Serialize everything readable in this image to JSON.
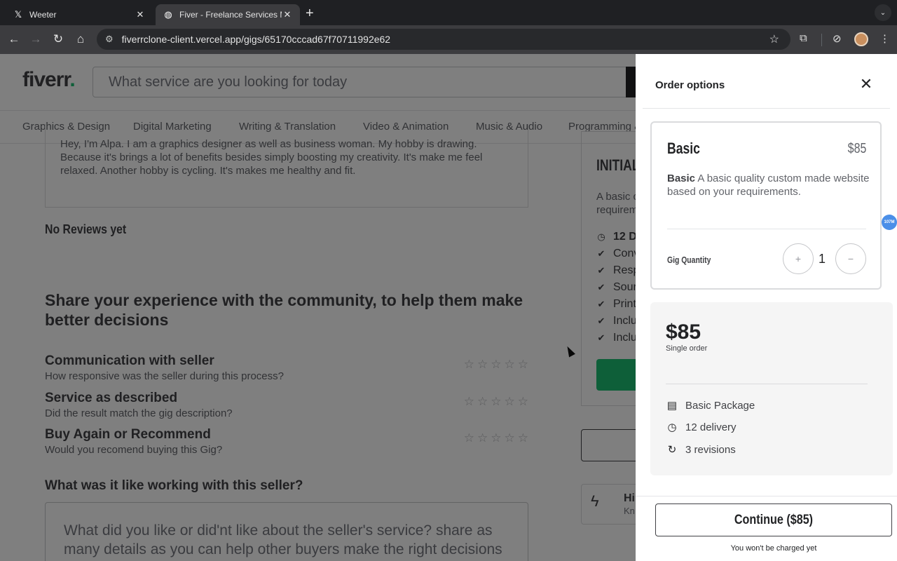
{
  "browser": {
    "tabs": [
      {
        "title": "Weeter",
        "favicon": "x-logo-icon",
        "active": false
      },
      {
        "title": "Fiver - Freelance Services Ma",
        "favicon": "globe-icon",
        "active": true
      }
    ],
    "url": "fiverrclone-client.vercel.app/gigs/65170cccad67f70711992e62"
  },
  "header": {
    "logo": "fiverr",
    "logo_dot": ".",
    "search_placeholder": "What service are you looking for today"
  },
  "categories": [
    "Graphics & Design",
    "Digital Marketing",
    "Writing & Translation",
    "Video & Animation",
    "Music & Audio",
    "Programming &"
  ],
  "seller_bio": "Hey, I'm Alpa. I am a graphics designer as well as business woman. My hobby is drawing. Because it's brings a lot of benefits besides simply boosting my creativity. It's make me feel relaxed. Another hobby is cycling. It's makes me healthy and fit.",
  "reviews": {
    "heading": "No Reviews yet",
    "share_title": "Share your experience with the community, to help them make better decisions",
    "criteria": [
      {
        "title": "Communication with seller",
        "subtitle": "How responsive was the seller during this process?"
      },
      {
        "title": "Service as described",
        "subtitle": "Did the result match the gig description?"
      },
      {
        "title": "Buy Again or Recommend",
        "subtitle": "Would you recomend buying this Gig?"
      }
    ],
    "working_title": "What was it like working with this seller?",
    "textarea_placeholder": "What did you like or did'nt like about the seller's service? share as many details as you can help other buyers make the right decisions fro their"
  },
  "package_card": {
    "name": "INITIAL I",
    "desc_line1": "A basic c",
    "desc_line2": "requirem",
    "lines": [
      {
        "icon": "clock-icon",
        "text": "12 D"
      },
      {
        "icon": "check-icon",
        "text": "Conv"
      },
      {
        "icon": "check-icon",
        "text": "Resp"
      },
      {
        "icon": "check-icon",
        "text": "Sour"
      },
      {
        "icon": "check-icon",
        "text": "Print"
      },
      {
        "icon": "check-icon",
        "text": "Inclu"
      },
      {
        "icon": "check-icon",
        "text": "Inclu"
      }
    ],
    "highlight_title": "Hi",
    "highlight_sub": "Kn"
  },
  "drawer": {
    "title": "Order options",
    "option": {
      "name": "Basic",
      "price": "$85",
      "desc_bold": "Basic",
      "desc": " A basic quality custom made website based on your requirements.",
      "qty_label": "Gig Quantity",
      "qty_plus": "+",
      "qty_value": "1",
      "qty_minus": "−"
    },
    "summary": {
      "price": "$85",
      "sub": "Single order",
      "items": [
        {
          "icon": "package-icon",
          "text": "Basic Package"
        },
        {
          "icon": "clock-icon",
          "text": "12 delivery"
        },
        {
          "icon": "revisions-icon",
          "text": "3 revisions"
        }
      ]
    },
    "continue_label": "Continue ($85)",
    "no_charge": "You won't be charged yet"
  },
  "extension_badge": "107M",
  "colors": {
    "brand_green": "#1dbf73",
    "overlay": "rgba(0,0,0,0.5)"
  }
}
